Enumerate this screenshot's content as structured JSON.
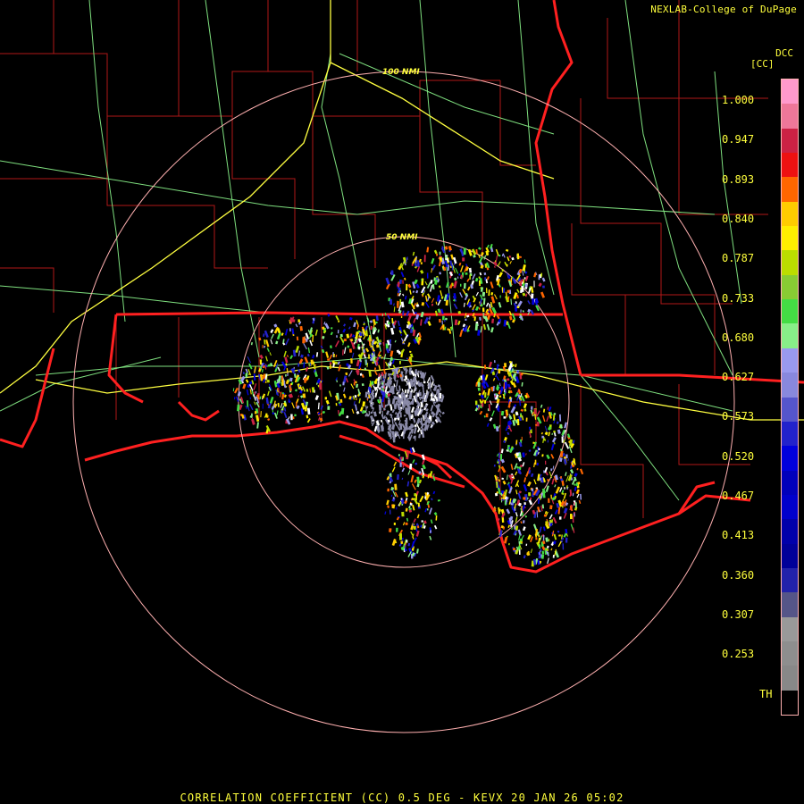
{
  "header": {
    "credit": "NEXLAB-College of DuPage",
    "product_code": "DCC",
    "unit_label": "[CC]"
  },
  "footer": {
    "title": "CORRELATION COEFFICIENT (CC) 0.5 DEG - KEVX 20 JAN 26 05:02"
  },
  "range_rings": [
    {
      "label": "100 NMI"
    },
    {
      "label": "50 NMI"
    }
  ],
  "color_scale": {
    "ticks": [
      "1.000",
      "0.947",
      "0.893",
      "0.840",
      "0.787",
      "0.733",
      "0.680",
      "0.627",
      "0.573",
      "0.520",
      "0.467",
      "0.413",
      "0.360",
      "0.307",
      "0.253",
      "TH"
    ],
    "colors": [
      "#ff99cc",
      "#ee7799",
      "#cc2244",
      "#ee1111",
      "#ff6600",
      "#ffcc00",
      "#ffee00",
      "#bbdd00",
      "#88cc33",
      "#44dd44",
      "#88ee88",
      "#9999ee",
      "#8888dd",
      "#5555cc",
      "#2222cc",
      "#0000dd",
      "#0000bb",
      "#0000cc",
      "#0000aa",
      "#000099",
      "#2222aa",
      "#555588",
      "#999999",
      "#8e8e8e",
      "#888888",
      "#000000"
    ]
  },
  "colors": {
    "state_border": "#ff2020",
    "county_border": "#c01818",
    "highway": "#80e080",
    "interstate": "#ffff40",
    "range_ring": "#ffb0b0",
    "label_text": "#ffff3c"
  }
}
